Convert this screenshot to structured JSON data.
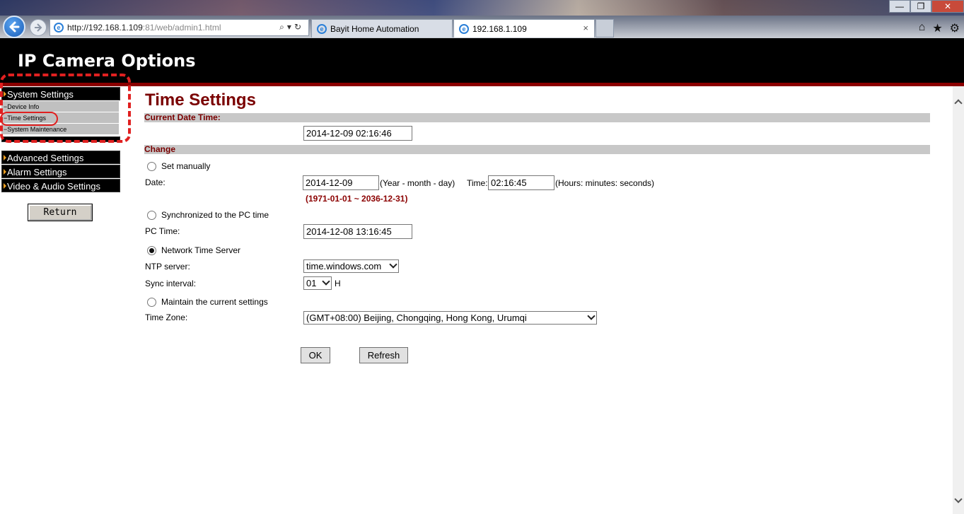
{
  "browser": {
    "url_main": "http://192.168.1.109",
    "url_rest": ":81/web/admin1.html",
    "tabs": [
      {
        "label": "Bayit Home Automation"
      },
      {
        "label": "192.168.1.109",
        "close": "×"
      }
    ],
    "icons": [
      "back-arrow-icon",
      "forward-arrow-icon",
      "ie-icon",
      "search-icon",
      "refresh-icon",
      "home-icon",
      "star-icon",
      "gear-icon"
    ],
    "window_controls": {
      "minimize": "—",
      "restore": "❐",
      "close": "✕"
    }
  },
  "header": {
    "title": "IP Camera Options",
    "accent_color": "#8b0000"
  },
  "sidebar": {
    "sections": [
      {
        "label": "System Settings"
      },
      {
        "label": "Advanced Settings"
      },
      {
        "label": "Alarm Settings"
      },
      {
        "label": "Video & Audio Settings"
      }
    ],
    "sub_items": [
      {
        "label": "−Device Info"
      },
      {
        "label": "−Time Settings"
      },
      {
        "label": "−System Maintenance"
      }
    ],
    "return_label": "Return"
  },
  "main": {
    "title": "Time Settings",
    "current_band": "Current Date Time:",
    "current_value": "2014-12-09 02:16:46",
    "change_band": "Change",
    "set_manually": "Set manually",
    "date_label": "Date:",
    "date_value": "2014-12-09",
    "date_hint": "(Year - month - day)",
    "time_label": "Time:",
    "time_value": "02:16:45",
    "time_hint": "(Hours: minutes: seconds)",
    "range_note": "(1971-01-01 ~ 2036-12-31)",
    "sync_pc": "Synchronized to the PC time",
    "pc_time_label": "PC Time:",
    "pc_time_value": "2014-12-08 13:16:45",
    "ntp_option": "Network Time Server",
    "ntp_server_label": "NTP server:",
    "ntp_server_value": "time.windows.com",
    "sync_interval_label": "Sync interval:",
    "sync_interval_value": "01",
    "sync_interval_unit": "H",
    "maintain": "Maintain the current settings",
    "timezone_label": "Time Zone:",
    "timezone_value": "(GMT+08:00) Beijing, Chongqing, Hong Kong, Urumqi",
    "ok_label": "OK",
    "refresh_label": "Refresh",
    "selected_mode": "Network Time Server"
  }
}
